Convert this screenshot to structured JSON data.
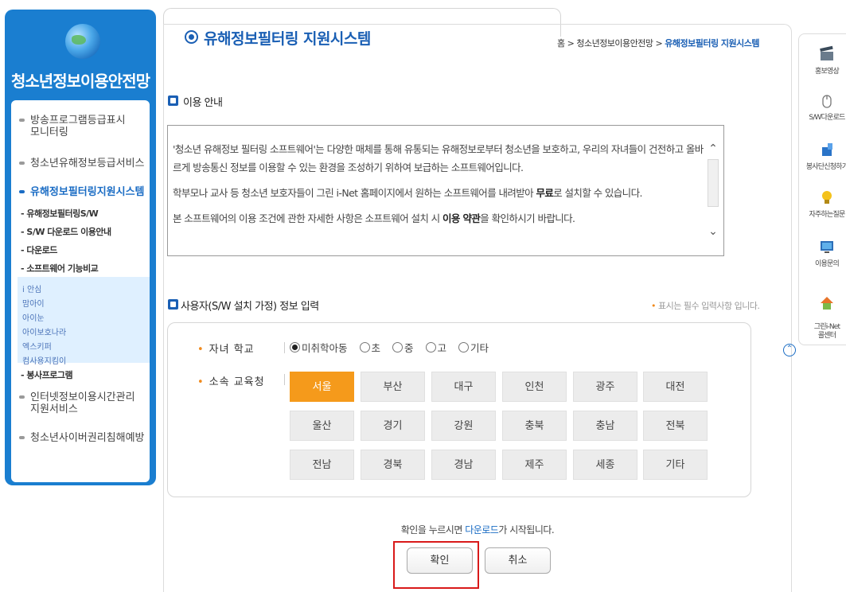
{
  "sidebar": {
    "title": "청소년정보이용안전망",
    "menu": [
      {
        "label": "방송프로그램등급표시\n모니터링"
      },
      {
        "label": "청소년유해정보등급서비스"
      },
      {
        "label": "유해정보필터링지원시스템"
      },
      {
        "label": "인터넷정보이용시간관리\n지원서비스"
      },
      {
        "label": "청소년사이버권리침해예방"
      }
    ],
    "submenu": [
      "- 유해정보필터링S/W",
      "- S/W 다운로드 이용안내",
      "- 다운로드",
      "- 소프트웨어 기능비교",
      "- 봉사프로그램"
    ],
    "subsub": [
      "i 안심",
      "맘아이",
      "아이눈",
      "아이보호나라",
      "엑스키퍼",
      "컴사용지킴이"
    ]
  },
  "header": {
    "title": "유해정보필터링 지원시스템",
    "breadcrumb_prefix": "홈 > 청소년정보이용안전망 > ",
    "breadcrumb_current": "유해정보필터링 지원시스템"
  },
  "usage": {
    "heading": "이용 안내",
    "p1": "'청소년 유해정보 필터링 소프트웨어'는 다양한 매체를 통해 유통되는 유해정보로부터 청소년을 보호하고, 우리의 자녀들이 건전하고 올바르게 방송통신 정보를 이용할 수 있는 환경을 조성하기 위하여 보급하는 소프트웨어입니다.",
    "p2a": "학부모나 교사 등 청소년 보호자들이 그린 i-Net 홈페이지에서 원하는 소프트웨어를 내려받아 ",
    "p2b": "무료",
    "p2c": "로 설치할 수 있습니다.",
    "p3a": "본 소프트웨어의 이용 조건에 관한 자세한 사항은 소프트웨어 설치 시 ",
    "p3b": "이용 약관",
    "p3c": "을 확인하시기 바랍니다."
  },
  "form": {
    "heading": "사용자(S/W 설치 가정) 정보 입력",
    "required_note": "표시는 필수 입력사항 입니다.",
    "required_mark": "•",
    "school_label": "자녀 학교",
    "school_options": [
      "미취학아동",
      "초",
      "중",
      "고",
      "기타"
    ],
    "school_selected": "미취학아동",
    "office_label": "소속 교육청",
    "regions": [
      "서울",
      "부산",
      "대구",
      "인천",
      "광주",
      "대전",
      "울산",
      "경기",
      "강원",
      "충북",
      "충남",
      "전북",
      "전남",
      "경북",
      "경남",
      "제주",
      "세종",
      "기타"
    ],
    "region_selected": "서울"
  },
  "action": {
    "notice_a": "확인을 누르시면 ",
    "notice_b": "다운로드",
    "notice_c": "가 시작됩니다.",
    "confirm_label": "확인",
    "cancel_label": "취소"
  },
  "quick": {
    "items": [
      "홍보영상",
      "S/W다운로드",
      "봉사단신청하기",
      "자주하는질문",
      "이용문의",
      "그린i-Net\n콜센터"
    ]
  },
  "colors": {
    "brand_blue": "#1a7ed0",
    "accent_orange": "#f59a1b",
    "highlight_red": "#d91a1a"
  }
}
